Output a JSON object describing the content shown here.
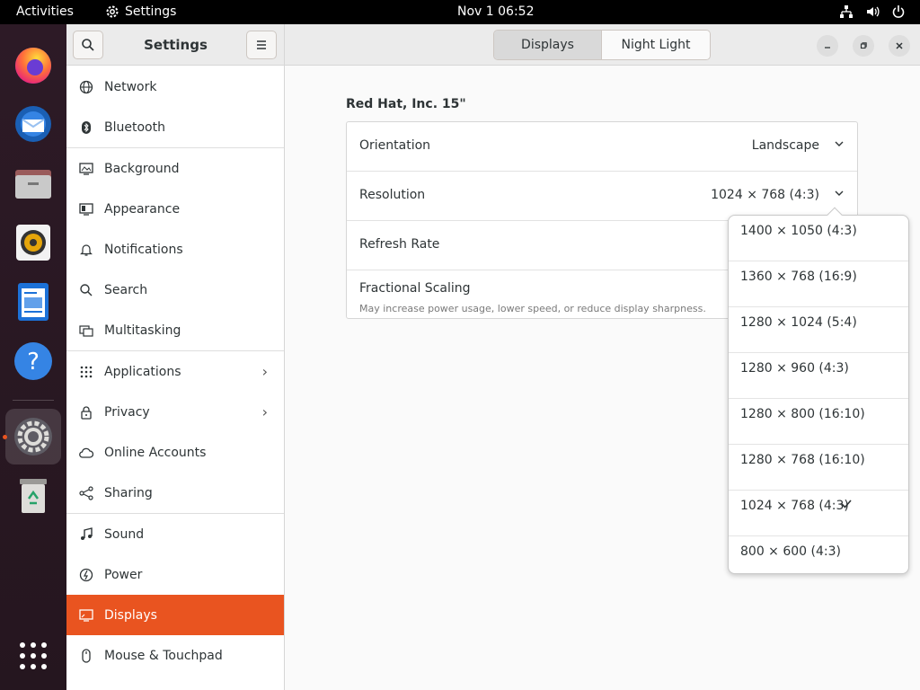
{
  "topbar": {
    "activities": "Activities",
    "app_name": "Settings",
    "clock": "Nov 1  06:52"
  },
  "dock": {
    "apps": [
      {
        "name": "Firefox",
        "icon": "firefox-icon"
      },
      {
        "name": "Thunderbird",
        "icon": "thunderbird-icon"
      },
      {
        "name": "Files",
        "icon": "files-icon"
      },
      {
        "name": "Rhythmbox",
        "icon": "rhythmbox-icon"
      },
      {
        "name": "LibreOffice Writer",
        "icon": "writer-icon"
      },
      {
        "name": "Help",
        "icon": "help-icon"
      },
      {
        "name": "Settings",
        "icon": "settings-icon"
      },
      {
        "name": "Trash",
        "icon": "trash-icon"
      }
    ]
  },
  "window": {
    "sidebar_title": "Settings",
    "tabs": [
      {
        "label": "Displays",
        "selected": true
      },
      {
        "label": "Night Light",
        "selected": false
      }
    ]
  },
  "sidebar": {
    "items": [
      {
        "label": "Network",
        "icon": "network-icon"
      },
      {
        "label": "Bluetooth",
        "icon": "bluetooth-icon"
      },
      {
        "label": "Background",
        "icon": "background-icon"
      },
      {
        "label": "Appearance",
        "icon": "appearance-icon"
      },
      {
        "label": "Notifications",
        "icon": "bell-icon"
      },
      {
        "label": "Search",
        "icon": "search-icon"
      },
      {
        "label": "Multitasking",
        "icon": "multitasking-icon"
      },
      {
        "label": "Applications",
        "icon": "apps-grid-icon"
      },
      {
        "label": "Privacy",
        "icon": "lock-icon"
      },
      {
        "label": "Online Accounts",
        "icon": "cloud-icon"
      },
      {
        "label": "Sharing",
        "icon": "share-icon"
      },
      {
        "label": "Sound",
        "icon": "music-note-icon"
      },
      {
        "label": "Power",
        "icon": "power-icon"
      },
      {
        "label": "Displays",
        "icon": "display-icon"
      },
      {
        "label": "Mouse & Touchpad",
        "icon": "mouse-icon"
      }
    ]
  },
  "display": {
    "monitor_name": "Red Hat, Inc. 15\"",
    "orientation_label": "Orientation",
    "orientation_value": "Landscape",
    "resolution_label": "Resolution",
    "resolution_value": "1024 × 768 (4:3)",
    "refresh_label": "Refresh Rate",
    "scaling_label": "Fractional Scaling",
    "scaling_sub": "May increase power usage, lower speed, or reduce display sharpness."
  },
  "resolution_popover": {
    "options": [
      "1400 × 1050 (4:3)",
      "1360 × 768 (16:9)",
      "1280 × 1024 (5:4)",
      "1280 × 960 (4:3)",
      "1280 × 800 (16:10)",
      "1280 × 768 (16:10)",
      "1024 × 768 (4:3)",
      "800 × 600 (4:3)"
    ],
    "selected": "1024 × 768 (4:3)"
  },
  "colors": {
    "accent": "#e95420",
    "dock_bg": "#2d1a26",
    "topbar_bg": "#000000"
  }
}
